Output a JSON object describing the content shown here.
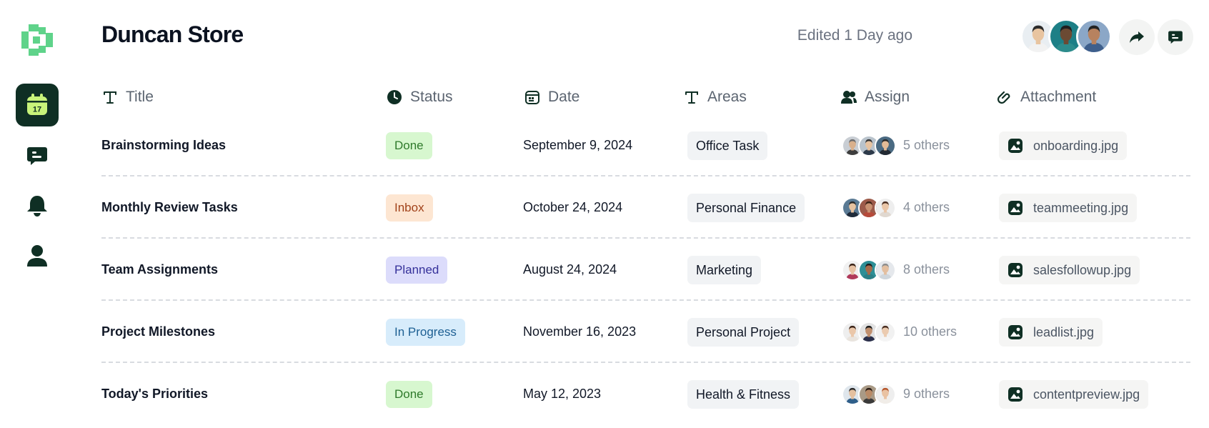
{
  "store": {
    "title": "Duncan Store",
    "edited": "Edited 1 Day ago"
  },
  "sidebar": {
    "logo_color": "#5fd38a",
    "active_bg": "#0f2f24",
    "active_icon_color": "#c8f37a",
    "calendar_day": "17",
    "items": [
      {
        "name": "calendar",
        "active": true
      },
      {
        "name": "messages",
        "active": false
      },
      {
        "name": "notifications",
        "active": false
      },
      {
        "name": "profile",
        "active": false
      }
    ]
  },
  "header": {
    "avatars": [
      {
        "skin": "#e8c4a0",
        "hair": "#2b2b2b",
        "shirt": "#f2f2f2",
        "bg": "#e9eef2"
      },
      {
        "skin": "#6b4a33",
        "hair": "#1f1f1f",
        "shirt": "#2c8c8c",
        "bg": "#1d7f86"
      },
      {
        "skin": "#b7825f",
        "hair": "#232323",
        "shirt": "#3e5f8c",
        "bg": "#8ba7c7"
      }
    ],
    "share_icon": "share-arrow-icon",
    "comment_icon": "comment-icon"
  },
  "columns": {
    "title": "Title",
    "status": "Status",
    "date": "Date",
    "areas": "Areas",
    "assign": "Assign",
    "attachment": "Attachment"
  },
  "status_colors": {
    "Done": {
      "bg": "#d7f7cf",
      "fg": "#2f7a2b"
    },
    "Inbox": {
      "bg": "#fde6d2",
      "fg": "#a1421a"
    },
    "Planned": {
      "bg": "#dcdcfb",
      "fg": "#35309a"
    },
    "In Progress": {
      "bg": "#d7ecfb",
      "fg": "#1d5f93"
    }
  },
  "rows": [
    {
      "title": "Brainstorming Ideas",
      "status": "Done",
      "date": "September 9, 2024",
      "area": "Office Task",
      "others": "5 others",
      "attachment": "onboarding.jpg",
      "avatars": [
        {
          "skin": "#d9b08c",
          "hair": "#6d6d6d",
          "shirt": "#3d3d3d",
          "bg": "#c9ced4"
        },
        {
          "skin": "#e6c2a0",
          "hair": "#333333",
          "shirt": "#2d3a4a",
          "bg": "#b9c3cc"
        },
        {
          "skin": "#e2bb97",
          "hair": "#2a2a2a",
          "shirt": "#222a33",
          "bg": "#4a6a82"
        }
      ]
    },
    {
      "title": "Monthly Review Tasks",
      "status": "Inbox",
      "date": "October 24, 2024",
      "area": "Personal Finance",
      "others": "4 others",
      "attachment": "teammeeting.jpg",
      "avatars": [
        {
          "skin": "#e6c2a0",
          "hair": "#2a2a2a",
          "shirt": "#1f2b3a",
          "bg": "#5a7a94"
        },
        {
          "skin": "#c99273",
          "hair": "#3b2316",
          "shirt": "#b64a3a",
          "bg": "#9c5a4a"
        },
        {
          "skin": "#eac6a8",
          "hair": "#4a2e22",
          "shirt": "#e0d8d0",
          "bg": "#eeeeee"
        }
      ]
    },
    {
      "title": "Team Assignments",
      "status": "Planned",
      "date": "August 24, 2024",
      "area": "Marketing",
      "others": "8 others",
      "attachment": "salesfollowup.jpg",
      "avatars": [
        {
          "skin": "#e7c3a5",
          "hair": "#3a2418",
          "shirt": "#b03a5a",
          "bg": "#f1f1f1"
        },
        {
          "skin": "#a46a4a",
          "hair": "#1e1e1e",
          "shirt": "#2a7f86",
          "bg": "#2d8f96"
        },
        {
          "skin": "#e3bfa0",
          "hair": "#8d8d8d",
          "shirt": "#cfd6dc",
          "bg": "#e5e8ec"
        }
      ]
    },
    {
      "title": "Project Milestones",
      "status": "In Progress",
      "date": "November 16, 2023",
      "area": "Personal Project",
      "others": "10 others",
      "attachment": "leadlist.jpg",
      "avatars": [
        {
          "skin": "#eac7aa",
          "hair": "#3d2519",
          "shirt": "#e9e4de",
          "bg": "#eeeeee"
        },
        {
          "skin": "#c08f6e",
          "hair": "#1c1c1c",
          "shirt": "#2a2f4a",
          "bg": "#e2e2e2"
        },
        {
          "skin": "#ebcbb0",
          "hair": "#4a2e20",
          "shirt": "#f5f5f5",
          "bg": "#f1f1f1"
        }
      ]
    },
    {
      "title": "Today's Priorities",
      "status": "Done",
      "date": "May 12, 2023",
      "area": "Health & Fitness",
      "others": "9 others",
      "attachment": "contentpreview.jpg",
      "avatars": [
        {
          "skin": "#e4c0a0",
          "hair": "#2a2a2a",
          "shirt": "#2f5f8a",
          "bg": "#dfe6ec"
        },
        {
          "skin": "#b98a66",
          "hair": "#2a1c14",
          "shirt": "#3a3a3a",
          "bg": "#a99a86"
        },
        {
          "skin": "#e9c2a2",
          "hair": "#b5562b",
          "shirt": "#f1ede8",
          "bg": "#eeeeee"
        }
      ]
    }
  ]
}
